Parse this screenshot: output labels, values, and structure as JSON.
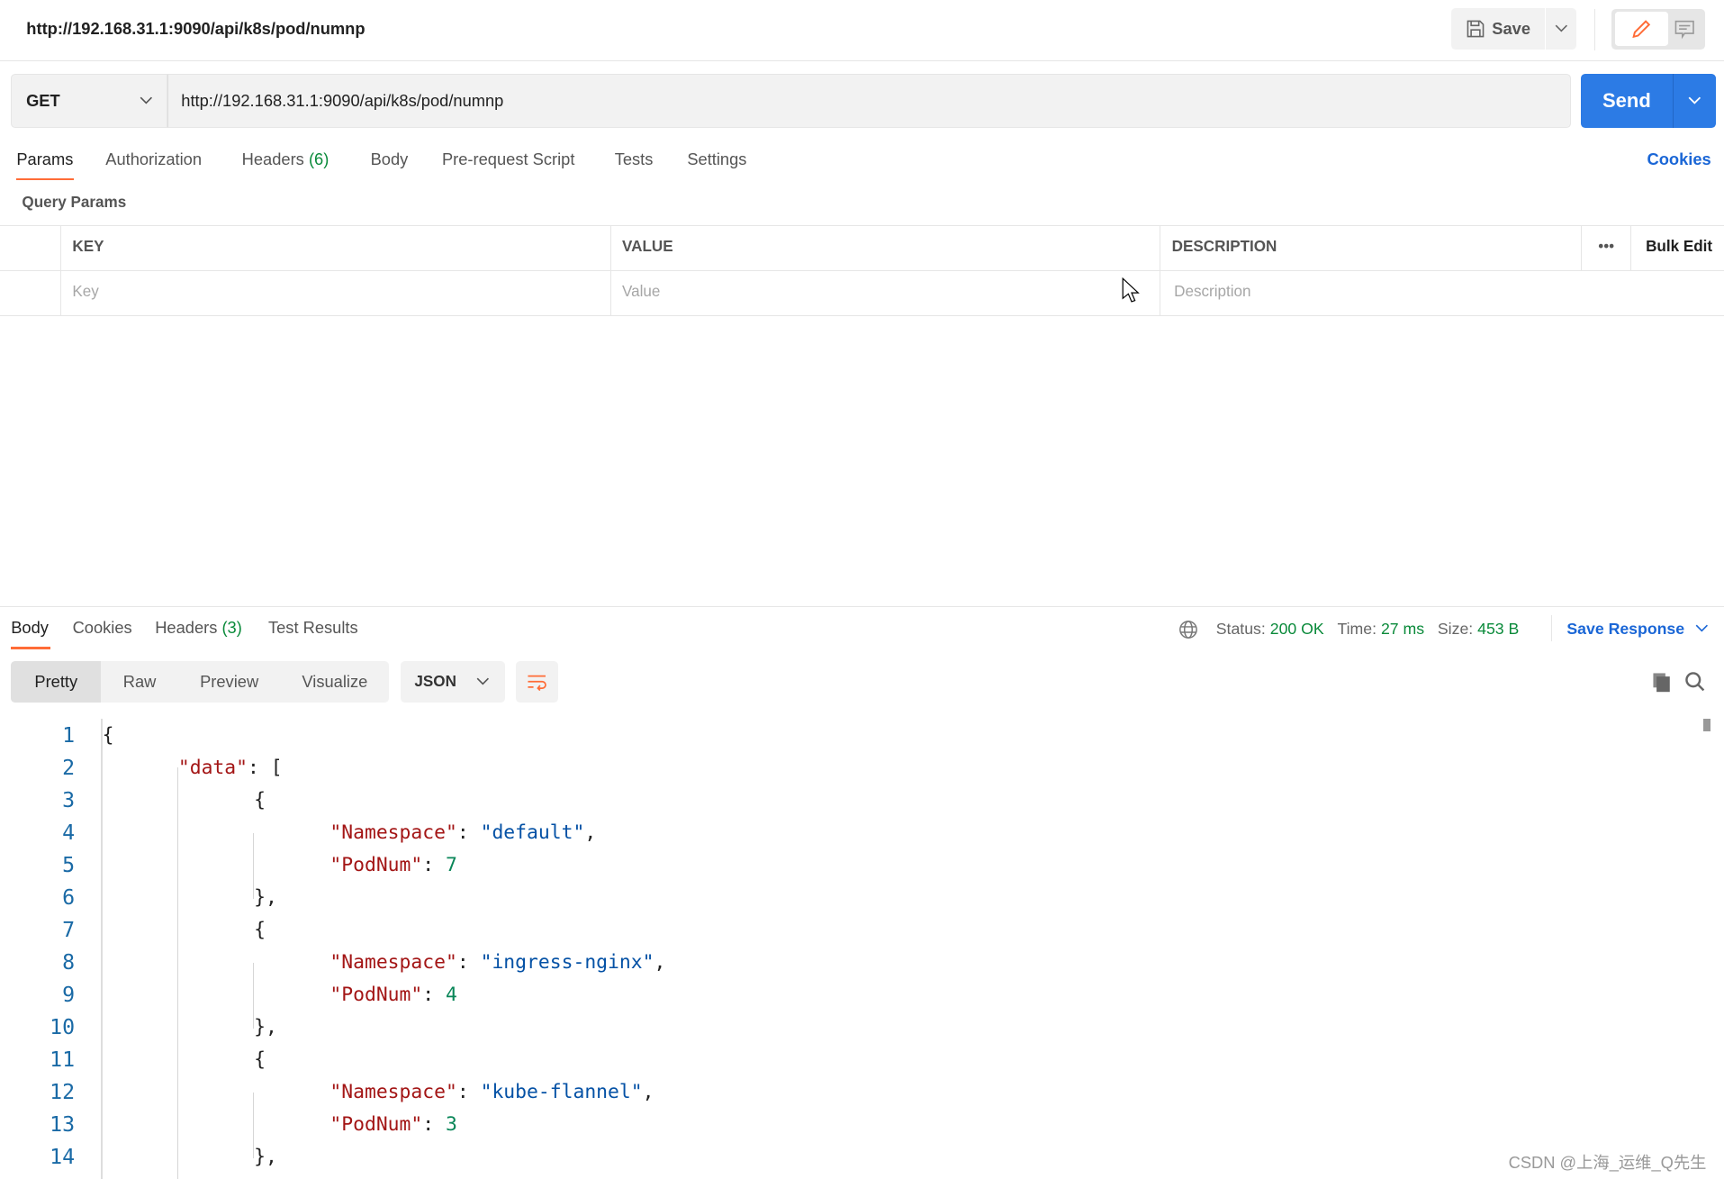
{
  "header": {
    "title": "http://192.168.31.1:9090/api/k8s/pod/numnp",
    "save_label": "Save"
  },
  "request": {
    "method": "GET",
    "url": "http://192.168.31.1:9090/api/k8s/pod/numnp",
    "send_label": "Send"
  },
  "request_tabs": [
    {
      "label": "Params",
      "active": true
    },
    {
      "label": "Authorization"
    },
    {
      "label": "Headers",
      "count": "(6)"
    },
    {
      "label": "Body"
    },
    {
      "label": "Pre-request Script"
    },
    {
      "label": "Tests"
    },
    {
      "label": "Settings"
    }
  ],
  "cookies_label": "Cookies",
  "query_params": {
    "title": "Query Params",
    "columns": [
      "KEY",
      "VALUE",
      "DESCRIPTION"
    ],
    "bulk_edit": "Bulk Edit",
    "placeholders": {
      "key": "Key",
      "value": "Value",
      "description": "Description"
    }
  },
  "response": {
    "tabs": [
      {
        "label": "Body",
        "active": true
      },
      {
        "label": "Cookies"
      },
      {
        "label": "Headers",
        "count": "(3)"
      },
      {
        "label": "Test Results"
      }
    ],
    "status_label": "Status:",
    "status": "200 OK",
    "time_label": "Time:",
    "time": "27 ms",
    "size_label": "Size:",
    "size": "453 B",
    "save_response": "Save Response",
    "view_modes": [
      "Pretty",
      "Raw",
      "Preview",
      "Visualize"
    ],
    "format": "JSON",
    "lines": [
      {
        "n": "1",
        "indent": 0,
        "parts": [
          [
            "p",
            "{"
          ]
        ]
      },
      {
        "n": "2",
        "indent": 1,
        "parts": [
          [
            "k",
            "\"data\""
          ],
          [
            "p",
            ": ["
          ]
        ]
      },
      {
        "n": "3",
        "indent": 2,
        "parts": [
          [
            "p",
            "{"
          ]
        ]
      },
      {
        "n": "4",
        "indent": 3,
        "parts": [
          [
            "k",
            "\"Namespace\""
          ],
          [
            "p",
            ": "
          ],
          [
            "s",
            "\"default\""
          ],
          [
            "p",
            ","
          ]
        ]
      },
      {
        "n": "5",
        "indent": 3,
        "parts": [
          [
            "k",
            "\"PodNum\""
          ],
          [
            "p",
            ": "
          ],
          [
            "n",
            "7"
          ]
        ]
      },
      {
        "n": "6",
        "indent": 2,
        "parts": [
          [
            "p",
            "},"
          ]
        ]
      },
      {
        "n": "7",
        "indent": 2,
        "parts": [
          [
            "p",
            "{"
          ]
        ]
      },
      {
        "n": "8",
        "indent": 3,
        "parts": [
          [
            "k",
            "\"Namespace\""
          ],
          [
            "p",
            ": "
          ],
          [
            "s",
            "\"ingress-nginx\""
          ],
          [
            "p",
            ","
          ]
        ]
      },
      {
        "n": "9",
        "indent": 3,
        "parts": [
          [
            "k",
            "\"PodNum\""
          ],
          [
            "p",
            ": "
          ],
          [
            "n",
            "4"
          ]
        ]
      },
      {
        "n": "10",
        "indent": 2,
        "parts": [
          [
            "p",
            "},"
          ]
        ]
      },
      {
        "n": "11",
        "indent": 2,
        "parts": [
          [
            "p",
            "{"
          ]
        ]
      },
      {
        "n": "12",
        "indent": 3,
        "parts": [
          [
            "k",
            "\"Namespace\""
          ],
          [
            "p",
            ": "
          ],
          [
            "s",
            "\"kube-flannel\""
          ],
          [
            "p",
            ","
          ]
        ]
      },
      {
        "n": "13",
        "indent": 3,
        "parts": [
          [
            "k",
            "\"PodNum\""
          ],
          [
            "p",
            ": "
          ],
          [
            "n",
            "3"
          ]
        ]
      },
      {
        "n": "14",
        "indent": 2,
        "parts": [
          [
            "p",
            "},"
          ]
        ]
      }
    ]
  },
  "colors": {
    "accent": "#ff6c37",
    "send": "#2c7be5",
    "link": "#1a66d6",
    "success": "#0a8a3a"
  },
  "watermark": "CSDN @上海_运维_Q先生"
}
